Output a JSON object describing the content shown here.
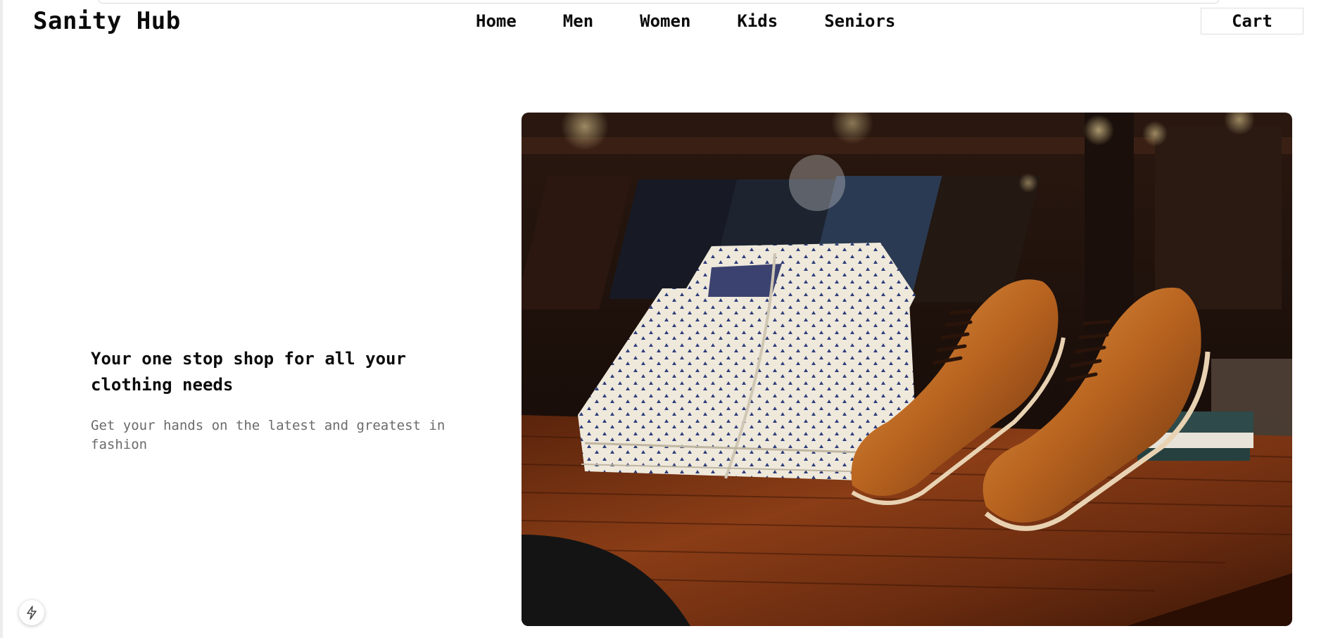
{
  "header": {
    "brand": "Sanity Hub",
    "nav": [
      {
        "label": "Home"
      },
      {
        "label": "Men"
      },
      {
        "label": "Women"
      },
      {
        "label": "Kids"
      },
      {
        "label": "Seniors"
      }
    ],
    "cart_label": "Cart"
  },
  "hero": {
    "title": "Your one stop shop for all your clothing needs",
    "subtitle": "Get your hands on the latest and greatest in fashion",
    "image": {
      "subject": "folded-shirt-and-brown-oxford-shoes-on-wooden-table",
      "colors": {
        "background": "#1b0f0a",
        "wood": "#6a2c10",
        "shirt": "#efe9dc",
        "shirt_pattern": "#2e3d7a",
        "leather": "#b96a25"
      }
    }
  },
  "floating_button": {
    "icon": "bolt-icon"
  }
}
